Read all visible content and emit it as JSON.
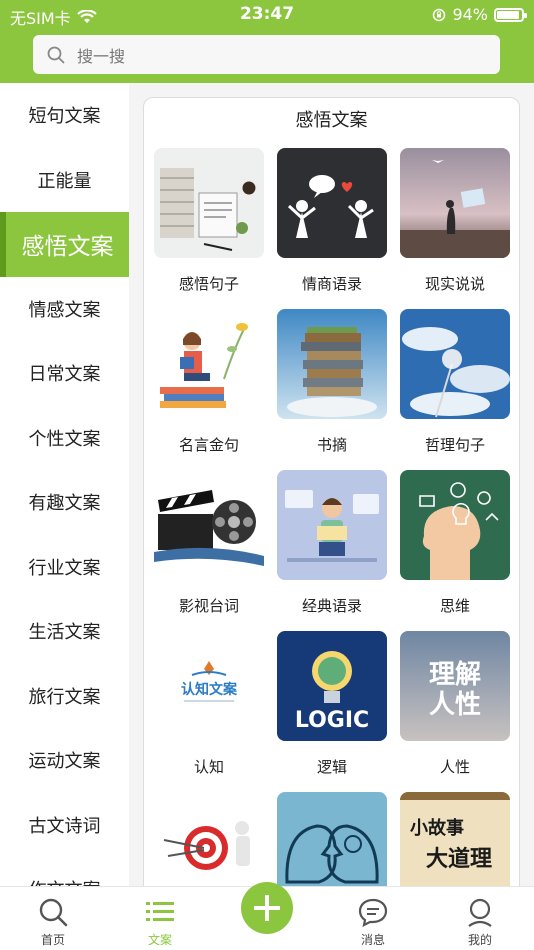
{
  "status": {
    "carrier": "无SIM卡",
    "time": "23:47",
    "battery": "94%"
  },
  "search": {
    "placeholder": "搜一搜"
  },
  "sidebar": {
    "items": [
      {
        "label": "短句文案"
      },
      {
        "label": "正能量"
      },
      {
        "label": "感悟文案",
        "active": true
      },
      {
        "label": "情感文案"
      },
      {
        "label": "日常文案"
      },
      {
        "label": "个性文案"
      },
      {
        "label": "有趣文案"
      },
      {
        "label": "行业文案"
      },
      {
        "label": "生活文案"
      },
      {
        "label": "旅行文案"
      },
      {
        "label": "运动文案"
      },
      {
        "label": "古文诗词"
      },
      {
        "label": "作文文案"
      }
    ]
  },
  "panel": {
    "title": "感悟文案",
    "tiles": [
      {
        "label": "感悟句子",
        "art": "desk-books"
      },
      {
        "label": "情商语录",
        "art": "two-people"
      },
      {
        "label": "现实说说",
        "art": "woman-field"
      },
      {
        "label": "名言金句",
        "art": "girl-reading"
      },
      {
        "label": "书摘",
        "art": "book-stack"
      },
      {
        "label": "哲理句子",
        "art": "dandelion"
      },
      {
        "label": "影视台词",
        "art": "film-clapper"
      },
      {
        "label": "经典语录",
        "art": "child-reading"
      },
      {
        "label": "思维",
        "art": "head-ideas"
      },
      {
        "label": "认知",
        "art": "logo-text"
      },
      {
        "label": "逻辑",
        "art": "logic-bulb"
      },
      {
        "label": "人性",
        "art": "sky-text"
      },
      {
        "label": "",
        "art": "target"
      },
      {
        "label": "",
        "art": "heads"
      },
      {
        "label": "",
        "art": "parchment"
      }
    ],
    "art_text": {
      "logo": "认知文案",
      "logic": "LOGIC",
      "humanity_1": "理解",
      "humanity_2": "人性",
      "story_1": "小故事",
      "story_2": "大道理"
    }
  },
  "tabbar": {
    "items": [
      {
        "label": "首页"
      },
      {
        "label": "文案",
        "active": true
      },
      {
        "label": ""
      },
      {
        "label": "消息"
      },
      {
        "label": "我的"
      }
    ]
  },
  "colors": {
    "accent": "#8cc63f",
    "accent_dark": "#5e9a1c"
  }
}
